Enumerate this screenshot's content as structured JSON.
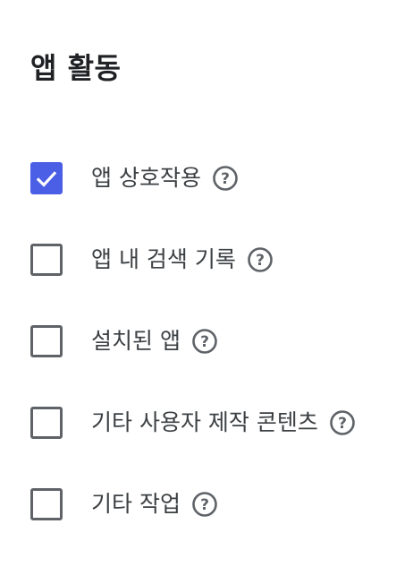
{
  "section": {
    "title": "앱 활동"
  },
  "items": [
    {
      "label": "앱 상호작용",
      "checked": true,
      "help_icon": "help-circle-icon"
    },
    {
      "label": "앱 내 검색 기록",
      "checked": false,
      "help_icon": "help-circle-icon"
    },
    {
      "label": "설치된 앱",
      "checked": false,
      "help_icon": "help-circle-icon"
    },
    {
      "label": "기타 사용자 제작 콘텐츠",
      "checked": false,
      "help_icon": "help-circle-icon"
    },
    {
      "label": "기타 작업",
      "checked": false,
      "help_icon": "help-circle-icon"
    }
  ],
  "colors": {
    "checkbox_checked": "#4a5ee6",
    "checkbox_border": "#5f6368",
    "help_icon": "#5f6368",
    "text": "#3c4043"
  }
}
